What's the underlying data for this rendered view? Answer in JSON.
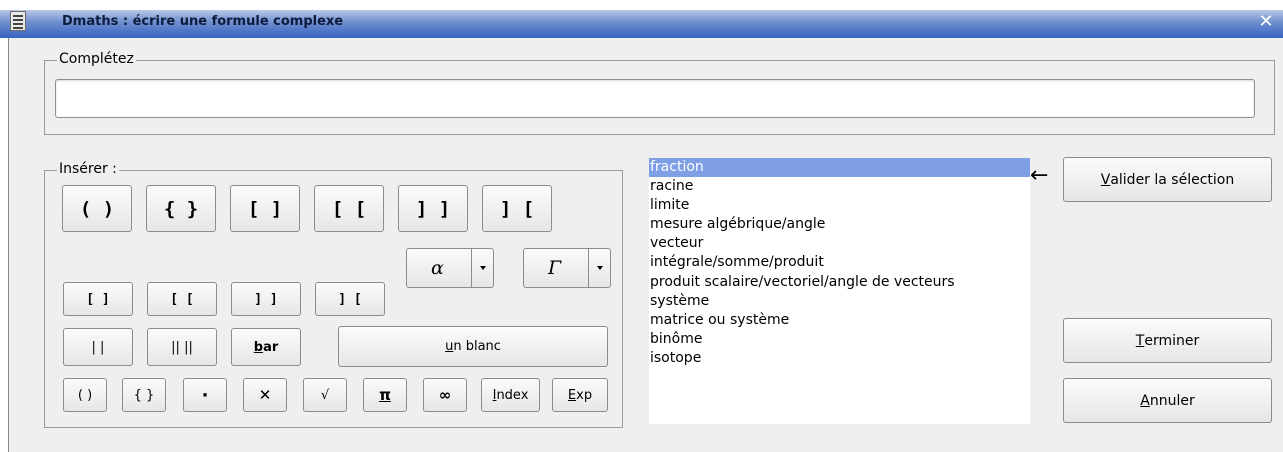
{
  "window": {
    "title": "Dmaths : écrire une formule complexe",
    "close_glyph": "✕"
  },
  "complete_group": {
    "legend": "Complétez",
    "formula_value": ""
  },
  "insert_group": {
    "legend": "Insérer :",
    "big_buttons": [
      "( )",
      "{ }",
      "[ ]",
      "[ [",
      "] ]",
      "] ["
    ],
    "medium_buttons": [
      "[ ]",
      "[ [",
      "] ]",
      "] ["
    ],
    "greek_lower": "α",
    "greek_upper": "Γ",
    "abs_button": "| |",
    "norm_button": "|| ||",
    "bar_button": {
      "mnemonic": "b",
      "rest": "ar"
    },
    "blank_button": {
      "mnemonic": "u",
      "rest": "n blanc"
    },
    "symbol_buttons": [
      "( )",
      "{ }",
      "·",
      "✕",
      "√",
      "π",
      "∞"
    ],
    "index_button": {
      "mnemonic": "I",
      "rest": "ndex"
    },
    "exp_button": {
      "mnemonic": "E",
      "rest": "xp"
    }
  },
  "formula_list": {
    "items": [
      "fraction",
      "racine",
      "limite",
      "mesure algébrique/angle",
      "vecteur",
      "intégrale/somme/produit",
      "produit scalaire/vectoriel/angle de vecteurs",
      "système",
      "matrice ou système",
      "binôme",
      "isotope"
    ],
    "selected_index": 0,
    "arrow": "←"
  },
  "actions": {
    "validate": {
      "mnemonic": "V",
      "rest": "alider la sélection"
    },
    "finish": {
      "mnemonic": "T",
      "rest": "erminer"
    },
    "cancel": {
      "mnemonic": "A",
      "rest": "nnuler"
    }
  }
}
